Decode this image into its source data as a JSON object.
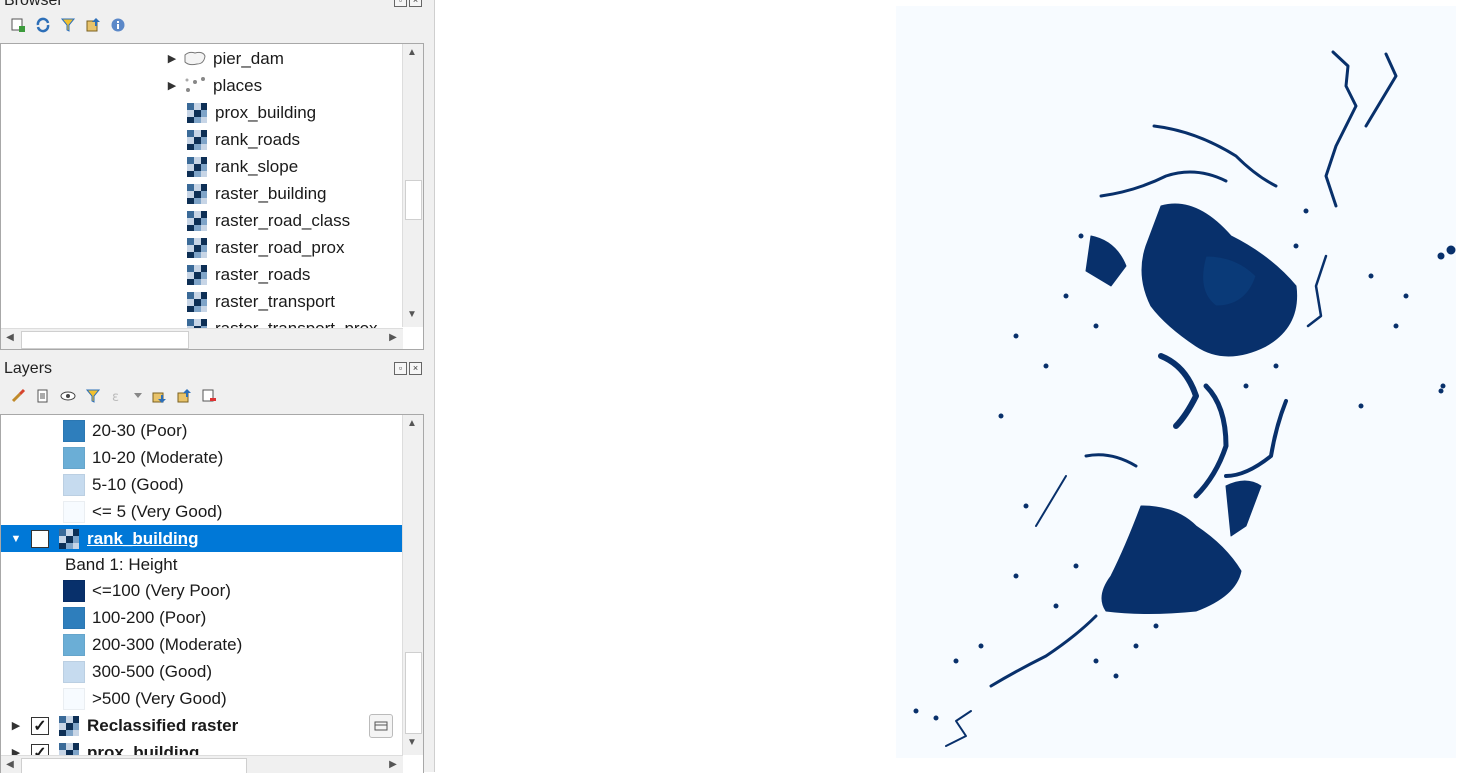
{
  "browser": {
    "title": "Browser",
    "items": [
      {
        "label": "pier_dam",
        "type": "polygon",
        "expandable": true
      },
      {
        "label": "places",
        "type": "point",
        "expandable": true
      },
      {
        "label": "prox_building",
        "type": "raster"
      },
      {
        "label": "rank_roads",
        "type": "raster"
      },
      {
        "label": "rank_slope",
        "type": "raster"
      },
      {
        "label": "raster_building",
        "type": "raster"
      },
      {
        "label": "raster_road_class",
        "type": "raster"
      },
      {
        "label": "raster_road_prox",
        "type": "raster"
      },
      {
        "label": "raster_roads",
        "type": "raster"
      },
      {
        "label": "raster_transport",
        "type": "raster"
      },
      {
        "label": "raster_transport_prox",
        "type": "raster"
      }
    ]
  },
  "layers": {
    "title": "Layers",
    "legend_above": [
      {
        "label": "20-30 (Poor)",
        "color": "#2e7ebc"
      },
      {
        "label": "10-20 (Moderate)",
        "color": "#6baed6"
      },
      {
        "label": "5-10 (Good)",
        "color": "#c6dbef"
      },
      {
        "label": "<= 5 (Very Good)",
        "color": "#f7fbff"
      }
    ],
    "selected_layer": {
      "label": "rank_building",
      "checked": true
    },
    "band_label": "Band 1: Height",
    "legend": [
      {
        "label": "<=100 (Very Poor)",
        "color": "#08306b"
      },
      {
        "label": "100-200 (Poor)",
        "color": "#2e7ebc"
      },
      {
        "label": "200-300 (Moderate)",
        "color": "#6baed6"
      },
      {
        "label": "300-500 (Good)",
        "color": "#c6dbef"
      },
      {
        "label": ">500 (Very Good)",
        "color": "#f7fbff"
      }
    ],
    "other_layers": [
      {
        "label": "Reclassified raster",
        "checked": true
      },
      {
        "label": "prox_building",
        "checked": true
      }
    ]
  },
  "map": {
    "background": "#f7fbff",
    "feature_color": "#08306b"
  }
}
